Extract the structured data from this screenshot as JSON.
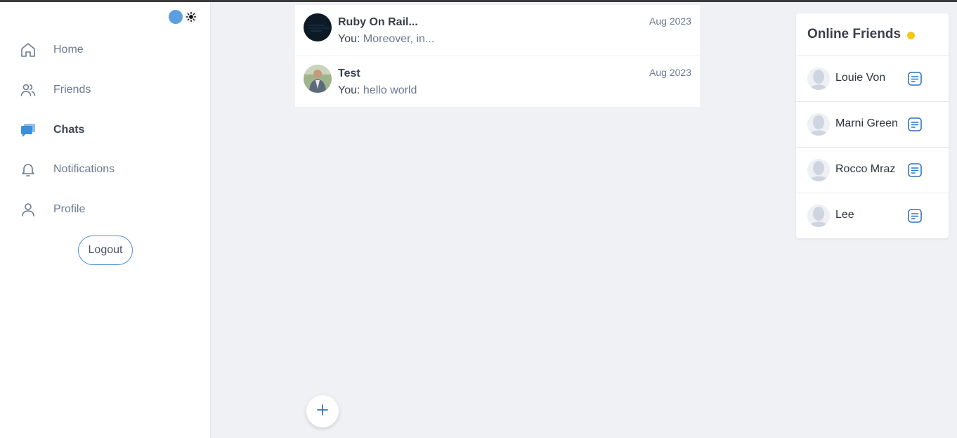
{
  "sidebar": {
    "nav": [
      {
        "label": "Home",
        "icon": "home-icon"
      },
      {
        "label": "Friends",
        "icon": "users-icon"
      },
      {
        "label": "Chats",
        "icon": "chat-bubbles-icon",
        "active": true
      },
      {
        "label": "Notifications",
        "icon": "bell-icon"
      },
      {
        "label": "Profile",
        "icon": "user-icon"
      }
    ],
    "logout_label": "Logout",
    "theme_toggle_icon": "sun-icon"
  },
  "chats": [
    {
      "name": "Ruby On Rail...",
      "date": "Aug 2023",
      "sender": "You:",
      "message": "Moreover, in..."
    },
    {
      "name": "Test",
      "date": "Aug 2023",
      "sender": "You:",
      "message": "hello world"
    }
  ],
  "new_chat_icon": "plus-icon",
  "online_friends": {
    "title": "Online Friends",
    "friends": [
      {
        "name": "Louie Von"
      },
      {
        "name": "Marni Green"
      },
      {
        "name": "Rocco Mraz"
      },
      {
        "name": "Lee"
      }
    ]
  },
  "colors": {
    "accent": "#4a90d9",
    "online": "#f5c518",
    "muted_text": "#6b7a90"
  }
}
